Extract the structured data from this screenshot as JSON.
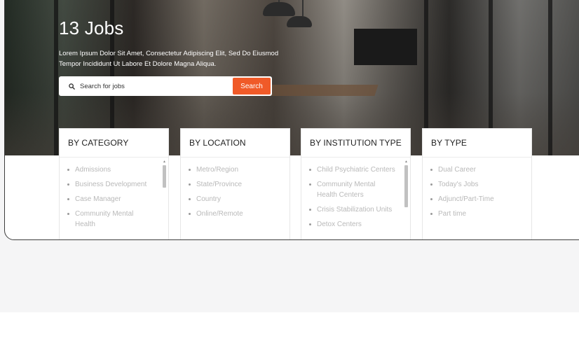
{
  "hero": {
    "title": "13 Jobs",
    "description": "Lorem Ipsum Dolor Sit Amet, Consectetur Adipiscing Elit, Sed Do Eiusmod Tempor Incididunt Ut Labore Et Dolore Magna Aliqua."
  },
  "search": {
    "placeholder": "Search for jobs",
    "button_label": "Search",
    "icon": "search-icon",
    "button_color": "#f05a28"
  },
  "filters": {
    "category": {
      "title": "BY CATEGORY",
      "items": [
        "Admissions",
        "Business Development",
        "Case Manager",
        "Community Mental Health"
      ]
    },
    "location": {
      "title": "BY LOCATION",
      "items": [
        "Metro/Region",
        "State/Province",
        "Country",
        "Online/Remote"
      ]
    },
    "institution": {
      "title": "BY INSTITUTION TYPE",
      "items": [
        "Child Psychiatric Centers",
        "Community Mental Health Centers",
        "Crisis Stabilization Units",
        "Detox Centers"
      ]
    },
    "type": {
      "title": "BY TYPE",
      "items": [
        "Dual Career",
        "Today's Jobs",
        "Adjunct/Part-Time",
        "Part time"
      ]
    }
  }
}
